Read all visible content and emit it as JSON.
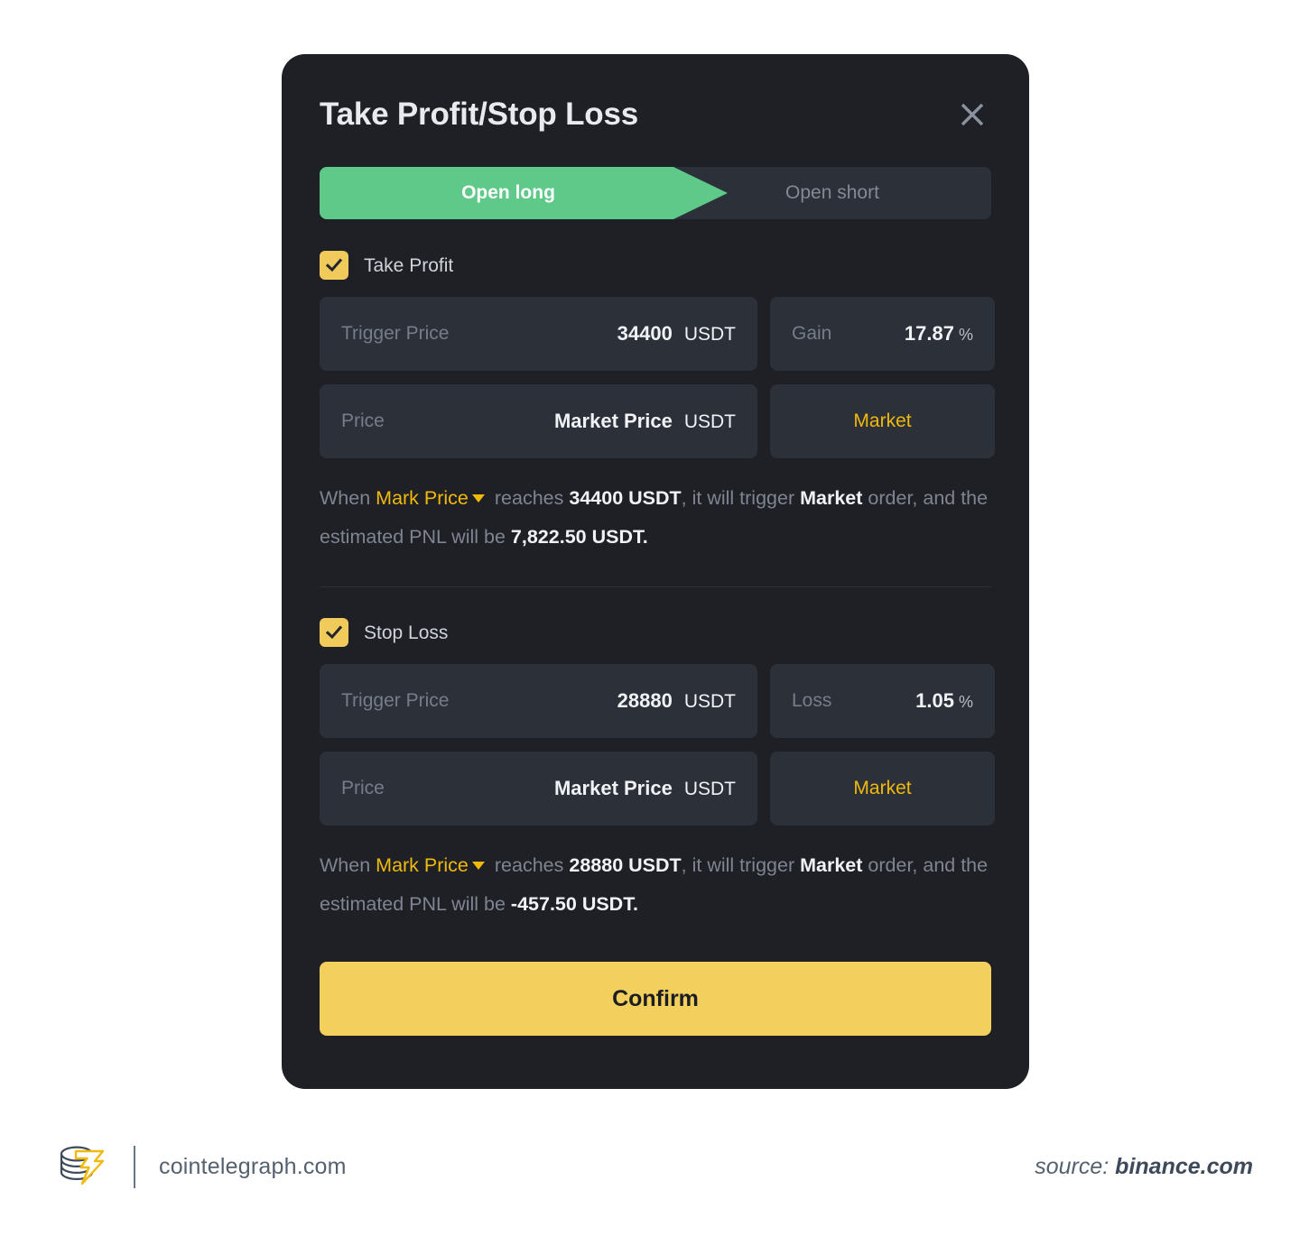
{
  "modal": {
    "title": "Take Profit/Stop Loss",
    "close_icon": "close-icon",
    "tabs": [
      {
        "label": "Open long",
        "active": true
      },
      {
        "label": "Open short",
        "active": false
      }
    ],
    "take_profit": {
      "checkbox_label": "Take Profit",
      "checked": true,
      "trigger": {
        "label": "Trigger Price",
        "value": "34400",
        "unit": "USDT"
      },
      "gain": {
        "label": "Gain",
        "value": "17.87",
        "unit": "%"
      },
      "price": {
        "label": "Price",
        "value": "Market Price",
        "unit": "USDT"
      },
      "order_type_button": "Market",
      "description": {
        "when": "When",
        "trigger_source": "Mark Price",
        "caret_icon": "chevron-down-icon",
        "reaches": "reaches",
        "trigger_value": "34400 USDT",
        "will_trigger": ", it will trigger",
        "order_type": "Market",
        "order_tail": "order, and the estimated PNL will be",
        "pnl": "7,822.50 USDT."
      }
    },
    "stop_loss": {
      "checkbox_label": "Stop Loss",
      "checked": true,
      "trigger": {
        "label": "Trigger Price",
        "value": "28880",
        "unit": "USDT"
      },
      "loss": {
        "label": "Loss",
        "value": "1.05",
        "unit": "%"
      },
      "price": {
        "label": "Price",
        "value": "Market Price",
        "unit": "USDT"
      },
      "order_type_button": "Market",
      "description": {
        "when": "When",
        "trigger_source": "Mark Price",
        "caret_icon": "chevron-down-icon",
        "reaches": "reaches",
        "trigger_value": "28880 USDT",
        "will_trigger": ", it will trigger",
        "order_type": "Market",
        "order_tail": "order, and the estimated PNL will be",
        "pnl": "-457.50 USDT."
      }
    },
    "confirm_label": "Confirm"
  },
  "footer": {
    "logo_icon": "cointelegraph-logo-icon",
    "site": "cointelegraph.com",
    "source_prefix": "source: ",
    "source_name": "binance.com"
  },
  "colors": {
    "page_bg": "#ffffff",
    "modal_bg": "#1e2026",
    "field_bg": "#2b3039",
    "accent_yellow": "#f0b90b",
    "confirm_yellow": "#f3d05d",
    "checkbox_yellow": "#f0cb5b",
    "long_green": "#5fc98a",
    "text_primary": "#f0f2f5",
    "text_muted": "#7e8591"
  }
}
